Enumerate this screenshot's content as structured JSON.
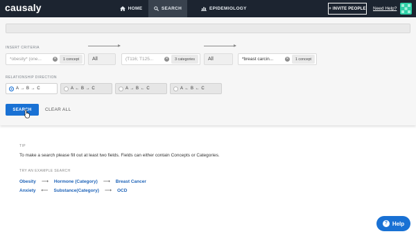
{
  "app": {
    "logo": "causaly"
  },
  "nav": {
    "home_label": "HOME",
    "search_label": "SEARCH",
    "epidemiology_label": "EPIDEMIOLOGY",
    "invite_label": "+ INVITE PEOPLE",
    "need_help_label": "Need Help?"
  },
  "search": {
    "criteria_label": "INSERT CRITERIA",
    "fields": [
      {
        "text": "*obesity* (one...",
        "badge": "1 concept"
      },
      {
        "text": "All"
      },
      {
        "text": "(T116; T125...",
        "badge": "3 categories"
      },
      {
        "text": "All"
      },
      {
        "text": "*breast carcin...",
        "badge": "1 concept"
      }
    ],
    "direction_label": "RELATIONSHIP DIRECTION",
    "direction_options": [
      {
        "text": "A → B → C",
        "selected": true
      },
      {
        "text": "A ← B → C",
        "selected": false
      },
      {
        "text": "A → B ← C",
        "selected": false
      },
      {
        "text": "A ← B ← C",
        "selected": false
      }
    ],
    "search_button": "SEARCH",
    "clear_all": "CLEAR ALL"
  },
  "tips": {
    "tip_label": "TIP",
    "tip_text": "To make a search please fill out at least two fields. Fields can either contain Concepts or Categories.",
    "example_label": "TRY AN EXAMPLE SEARCH",
    "examples": [
      {
        "a": "Obesity",
        "sep1": "⟶",
        "b": "Hormone (Category)",
        "sep2": "⟶",
        "c": "Breast Cancer"
      },
      {
        "a": "Anxiety",
        "sep1": "⟵",
        "b": "Substance(Category)",
        "sep2": "⟶",
        "c": "OCD"
      }
    ]
  },
  "help": {
    "label": "Help"
  },
  "colors": {
    "nav_bg": "#1c2430",
    "accent": "#1971d4",
    "link": "#1e63b8"
  }
}
